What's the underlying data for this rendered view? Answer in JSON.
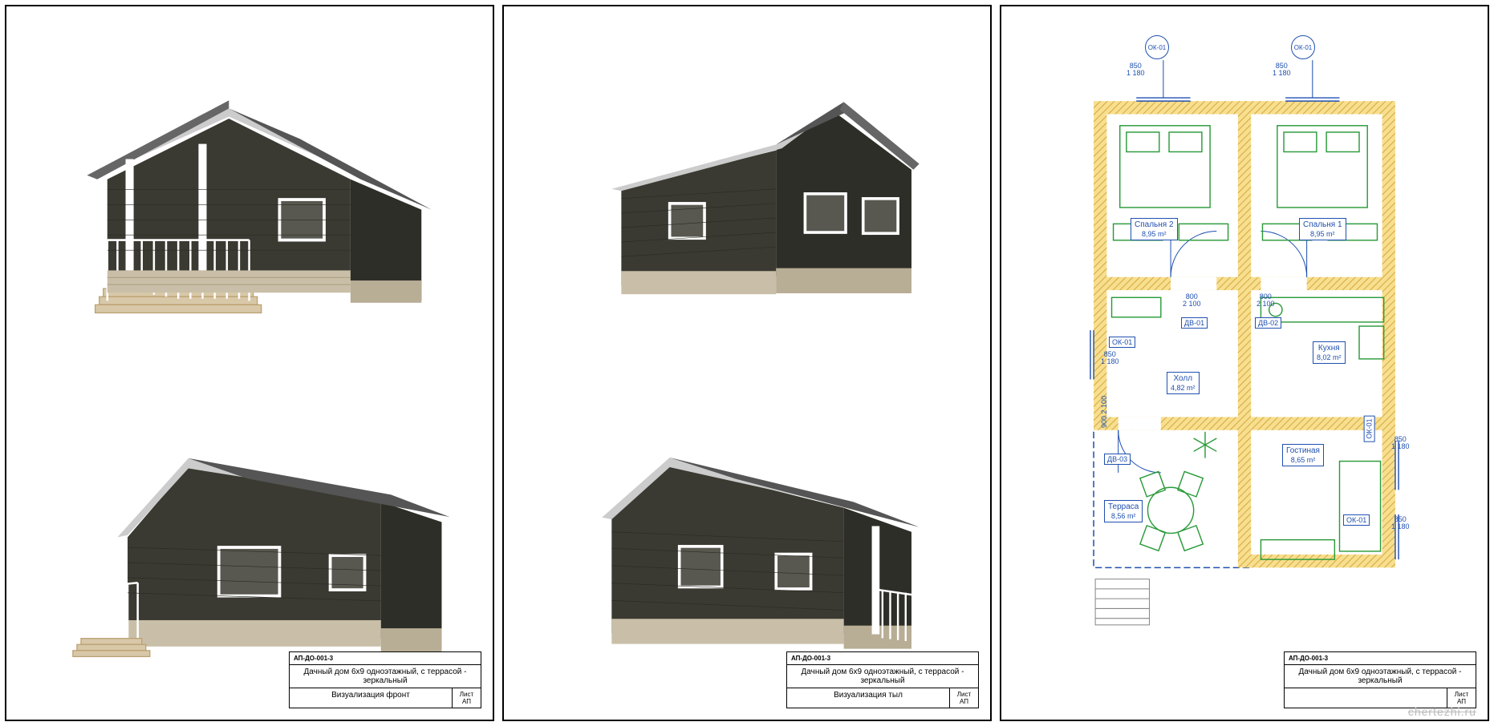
{
  "doc_code": "АП-ДО-001-3",
  "doc_title": "Дачный дом 6х9 одноэтажный, с террасой - зеркальный",
  "leaf_label": "Лист",
  "leaf_code": "АП",
  "sheets": {
    "s1": {
      "caption": "Визуализация фронт"
    },
    "s2": {
      "caption": "Визуализация тыл"
    },
    "s3": {
      "caption": ""
    }
  },
  "plan": {
    "rooms": {
      "bed2": {
        "name": "Спальня 2",
        "area": "8,95 m²"
      },
      "bed1": {
        "name": "Спальня 1",
        "area": "8,95 m²"
      },
      "hall": {
        "name": "Холл",
        "area": "4,82 m²"
      },
      "kitchen": {
        "name": "Кухня",
        "area": "8,02 m²"
      },
      "living": {
        "name": "Гостиная",
        "area": "8,65 m²"
      },
      "terrace": {
        "name": "Терраса",
        "area": "8,56 m²"
      }
    },
    "windows": {
      "ok01": "ОК-01"
    },
    "doors": {
      "dv01": "ДВ-01",
      "dv02": "ДВ-02",
      "dv03": "ДВ-03"
    },
    "dims": {
      "w850": "850",
      "h1180": "1 180",
      "d800": "800",
      "d2100": "2 100",
      "d900": "900"
    }
  },
  "watermark": "chertezhi.ru"
}
